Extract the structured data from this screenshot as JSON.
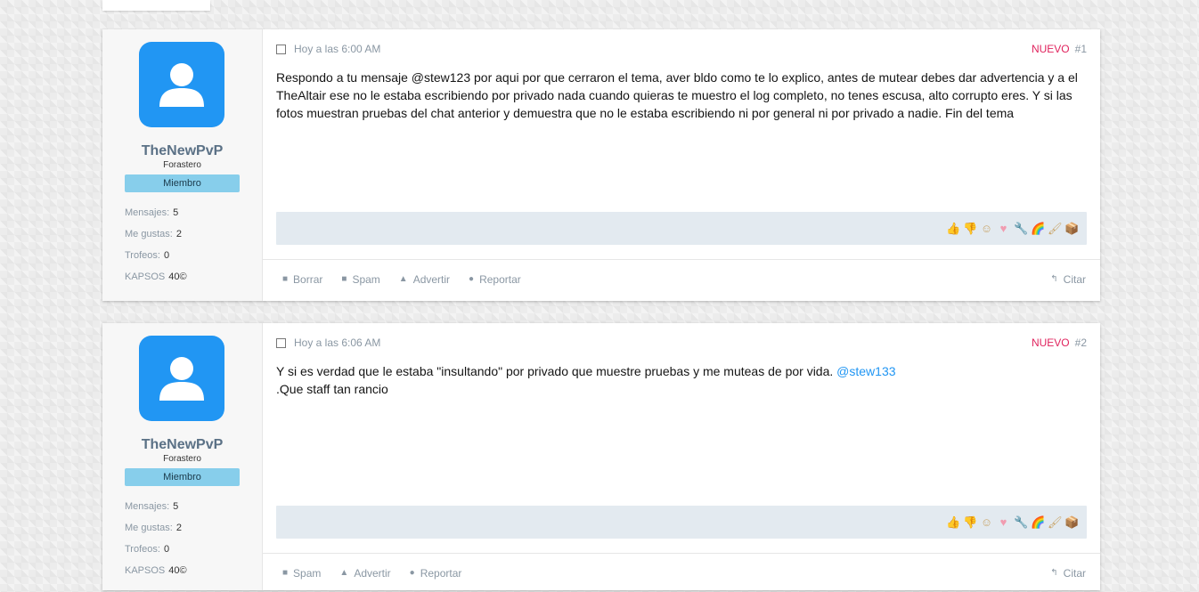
{
  "posts": [
    {
      "author": "TheNewPvP",
      "user_title": "Forastero",
      "rank": "Miembro",
      "stats": [
        {
          "label": "Mensajes:",
          "value": "5"
        },
        {
          "label": "Me gustas:",
          "value": "2"
        },
        {
          "label": "Trofeos:",
          "value": "0"
        },
        {
          "label": "KAPSOS",
          "value": "40©"
        }
      ],
      "timestamp": "Hoy a las 6:00 AM",
      "new_label": "NUEVO",
      "number": "#1",
      "message": "Respondo a tu mensaje @stew123 por aqui por que cerraron el tema, aver bldo como te lo explico, antes de mutear debes dar advertencia y a el TheAltair ese no le estaba escribiendo por privado nada cuando quieras te muestro el log completo, no tenes escusa, alto corrupto eres. Y si las fotos muestran pruebas del chat anterior y demuestra que no le estaba escribiendo ni por general ni por privado a nadie. Fin del tema",
      "actions": [
        "Borrar",
        "Spam",
        "Advertir",
        "Reportar"
      ],
      "quote": "Citar"
    },
    {
      "author": "TheNewPvP",
      "user_title": "Forastero",
      "rank": "Miembro",
      "stats": [
        {
          "label": "Mensajes:",
          "value": "5"
        },
        {
          "label": "Me gustas:",
          "value": "2"
        },
        {
          "label": "Trofeos:",
          "value": "0"
        },
        {
          "label": "KAPSOS",
          "value": "40©"
        }
      ],
      "timestamp": "Hoy a las 6:06 AM",
      "new_label": "NUEVO",
      "number": "#2",
      "message_part1": "Y si es verdad que le estaba \"insultando\" por privado que muestre pruebas y me muteas de por vida. ",
      "mention": "@stew133",
      "message_part2": ".Que staff tan rancio",
      "actions": [
        "Spam",
        "Advertir",
        "Reportar"
      ],
      "quote": "Citar"
    }
  ],
  "reactions": [
    "thumbs-up-icon",
    "thumbs-down-icon",
    "smile-icon",
    "heart-icon",
    "wrench-icon",
    "rainbow-icon",
    "brush-icon",
    "box-icon"
  ],
  "colors": {
    "accent": "#2196f3",
    "new": "#e0245e",
    "rank": "#87ceeb"
  }
}
